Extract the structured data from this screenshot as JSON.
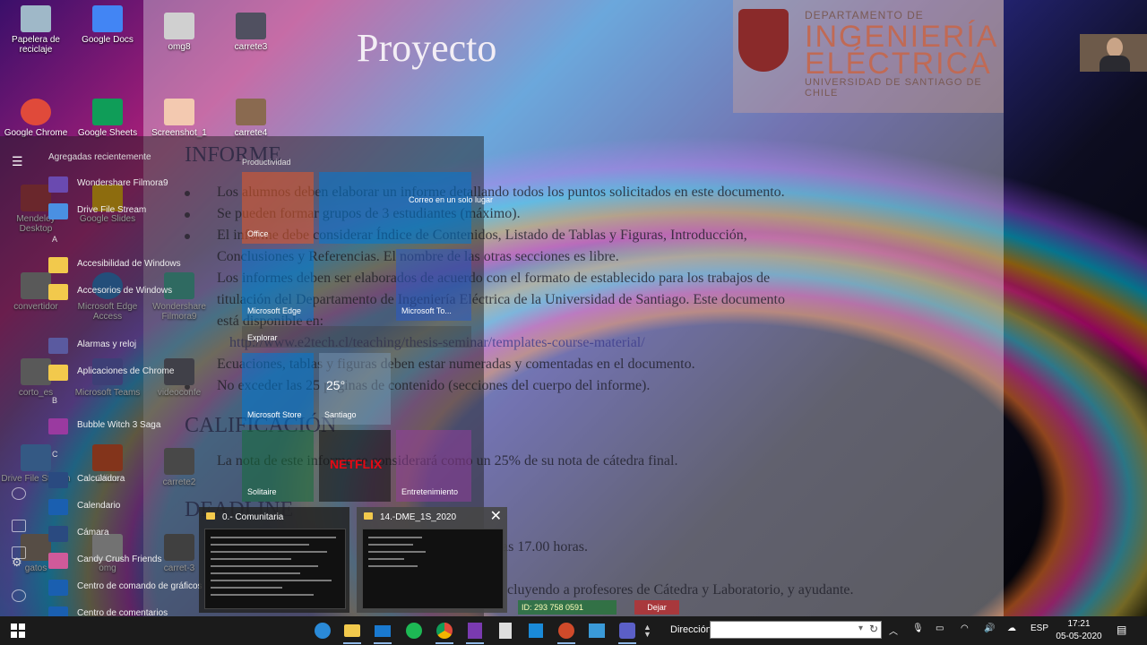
{
  "slide": {
    "title": "Proyecto",
    "logo": {
      "line1": "DEPARTAMENTO DE",
      "line2": "INGENIERÍA",
      "line3": "ELÉCTRICA",
      "line4": "UNIVERSIDAD DE SANTIAGO DE CHILE"
    },
    "sections": {
      "informe": "INFORME",
      "calificacion": "CALIFICACIÓN",
      "deadline": "DEADLINE"
    },
    "lines": [
      "Los alumnos deben elaborar un informe detallando todos los puntos solicitados en este documento.",
      "Se pueden formar grupos de 3 estudiantes (máximo).",
      "El informe debe considerar Índice de Contenidos, Listado de Tablas y Figuras, Introducción,",
      "Conclusiones y Referencias. El nombre de las otras secciones es libre.",
      "Los informes deben ser elaborados de acuerdo con el formato de establecido para los trabajos de",
      "titulación del Departamento de Ingeniería Eléctrica de la Universidad de Santiago. Este documento",
      "está disponible en:",
      "http://www.e2tech.cl/teaching/thesis-seminar/templates-course-material/",
      "Ecuaciones, tablas y figuras deben estar numeradas y comentadas en el documento.",
      "No exceder las 25 páginas de contenido (secciones del cuerpo del informe).",
      "La nota de este informe se considerará como un 25% de su nota de cátedra final.",
      "as 17.00 horas.",
      "cluyendo a profesores de Cátedra y Laboratorio, y ayudante."
    ]
  },
  "desktop_icons": [
    {
      "label": "Papelera de reciclaje",
      "color": "#9fb8c8"
    },
    {
      "label": "Google Docs",
      "color": "#4285f4"
    },
    {
      "label": "omg8",
      "color": "#d0d0d0"
    },
    {
      "label": "carrete3",
      "color": "#505060"
    },
    {
      "label": "Google Chrome",
      "color": "#e04a3a"
    },
    {
      "label": "Google Sheets",
      "color": "#0f9d58"
    },
    {
      "label": "Screenshot_1",
      "color": "#f3c9b0"
    },
    {
      "label": "carrete4",
      "color": "#8a6a50"
    },
    {
      "label": "Mendeley Desktop",
      "color": "#b0303a"
    },
    {
      "label": "Google Slides",
      "color": "#f4b400"
    },
    {
      "label": "Drive File Stream",
      "color": "#4a90e2"
    },
    {
      "label": "Office",
      "color": "#e04a1a"
    },
    {
      "label": "carrete2",
      "color": "#707070"
    },
    {
      "label": "carret-3",
      "color": "#606060"
    },
    {
      "label": "gatos",
      "color": "#8a7a6a"
    },
    {
      "label": "omg",
      "color": "#c0c0c0"
    },
    {
      "label": "videoconfe",
      "color": "#606070"
    },
    {
      "label": "Microsoft Edge Access",
      "color": "#2a7bd0"
    },
    {
      "label": "Wondershare Filmora9",
      "color": "#40b0a0"
    },
    {
      "label": "Microsoft Teams",
      "color": "#5b5fc7"
    },
    {
      "label": "corto_es",
      "color": "#909090"
    },
    {
      "label": "convertidor",
      "color": "#909090"
    }
  ],
  "start_menu": {
    "recent_header": "Agregadas recientemente",
    "items": [
      {
        "label": "Wondershare Filmora9",
        "color": "#6a4ab0"
      },
      {
        "label": "Drive File Stream",
        "color": "#4a90e2"
      },
      {
        "label": "Accesibilidad de Windows",
        "color": "#f2c94c"
      },
      {
        "label": "Accesorios de Windows",
        "color": "#f2c94c"
      },
      {
        "label": "Alarmas y reloj",
        "color": "#5a5aa0"
      },
      {
        "label": "Aplicaciones de Chrome",
        "color": "#f2c94c"
      },
      {
        "label": "Bubble Witch 3 Saga",
        "color": "#9a3aa0"
      },
      {
        "label": "Calculadora",
        "color": "#2a4a80"
      },
      {
        "label": "Calendario",
        "color": "#1a5fb0"
      },
      {
        "label": "Cámara",
        "color": "#2a4a80"
      },
      {
        "label": "Candy Crush Friends",
        "color": "#d05a9a"
      },
      {
        "label": "Centro de comando de gráficos",
        "color": "#1a5fb0"
      },
      {
        "label": "Centro de comentarios",
        "color": "#1a5fb0"
      }
    ],
    "letters": {
      "a": "A",
      "b": "B",
      "c": "C"
    },
    "tiles_header": "Productividad",
    "tiles": [
      {
        "label": "Office",
        "color": "rgba(230,90,40,.55)"
      },
      {
        "label": "Correo en un solo lugar",
        "color": "rgba(0,120,212,.55)"
      },
      {
        "label": "Microsoft Edge",
        "color": "rgba(0,120,212,.55)"
      },
      {
        "label": "Microsoft To...",
        "color": "rgba(40,90,200,.55)"
      },
      {
        "label": "Explorar",
        "color": "rgba(60,60,60,.5)"
      },
      {
        "label": "Microsoft Store",
        "color": "rgba(0,120,212,.55)"
      },
      {
        "label": "Santiago",
        "color": "rgba(120,150,180,.5)"
      },
      {
        "label": "Solitaire",
        "color": "rgba(20,110,60,.55)"
      },
      {
        "label": "NETFLIX",
        "color": "rgba(20,20,20,.6)"
      },
      {
        "label": "Entretenimiento",
        "color": "rgba(150,60,160,.5)"
      }
    ],
    "weather_temp": "25°"
  },
  "previews": [
    {
      "title": "0.- Comunitaria"
    },
    {
      "title": "14.-DME_1S_2020",
      "close": "✕"
    }
  ],
  "zoom_bar": {
    "id": "ID: 293 758 0591",
    "leave": "Dejar"
  },
  "taskbar": {
    "address_label": "Dirección",
    "address_value": "",
    "language": "ESP",
    "time": "17:21",
    "date": "05-05-2020",
    "icons": [
      "edge-icon",
      "file-explorer-icon",
      "mail-icon",
      "spotify-icon",
      "chrome-icon",
      "onenote-icon",
      "calculator-icon",
      "mediaplayer-icon",
      "powerpoint-icon",
      "photos-icon",
      "teams-icon"
    ]
  }
}
